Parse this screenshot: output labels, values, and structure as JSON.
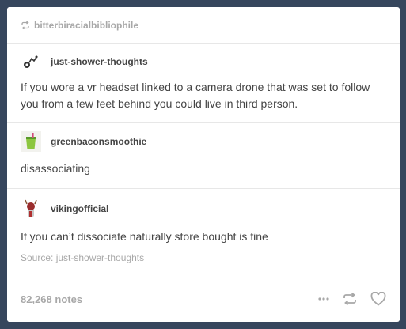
{
  "post": {
    "reblog_user": "bitterbiracialbibliophile",
    "entries": [
      {
        "username": "just-shower-thoughts",
        "text": "If you wore a vr headset linked to a camera drone that was set to follow you from a few feet behind you could live in third person."
      },
      {
        "username": "greenbaconsmoothie",
        "text": "disassociating"
      },
      {
        "username": "vikingofficial",
        "text": "If you can’t dissociate naturally store bought is fine",
        "source": "Source: just-shower-thoughts"
      }
    ],
    "notes": "82,268 notes"
  },
  "icons": {
    "reblog": "reblog-icon",
    "more": "more-icon",
    "heart": "heart-icon"
  },
  "colors": {
    "background": "#36465d",
    "muted_text": "#a8a8a8",
    "body_text": "#444444"
  }
}
